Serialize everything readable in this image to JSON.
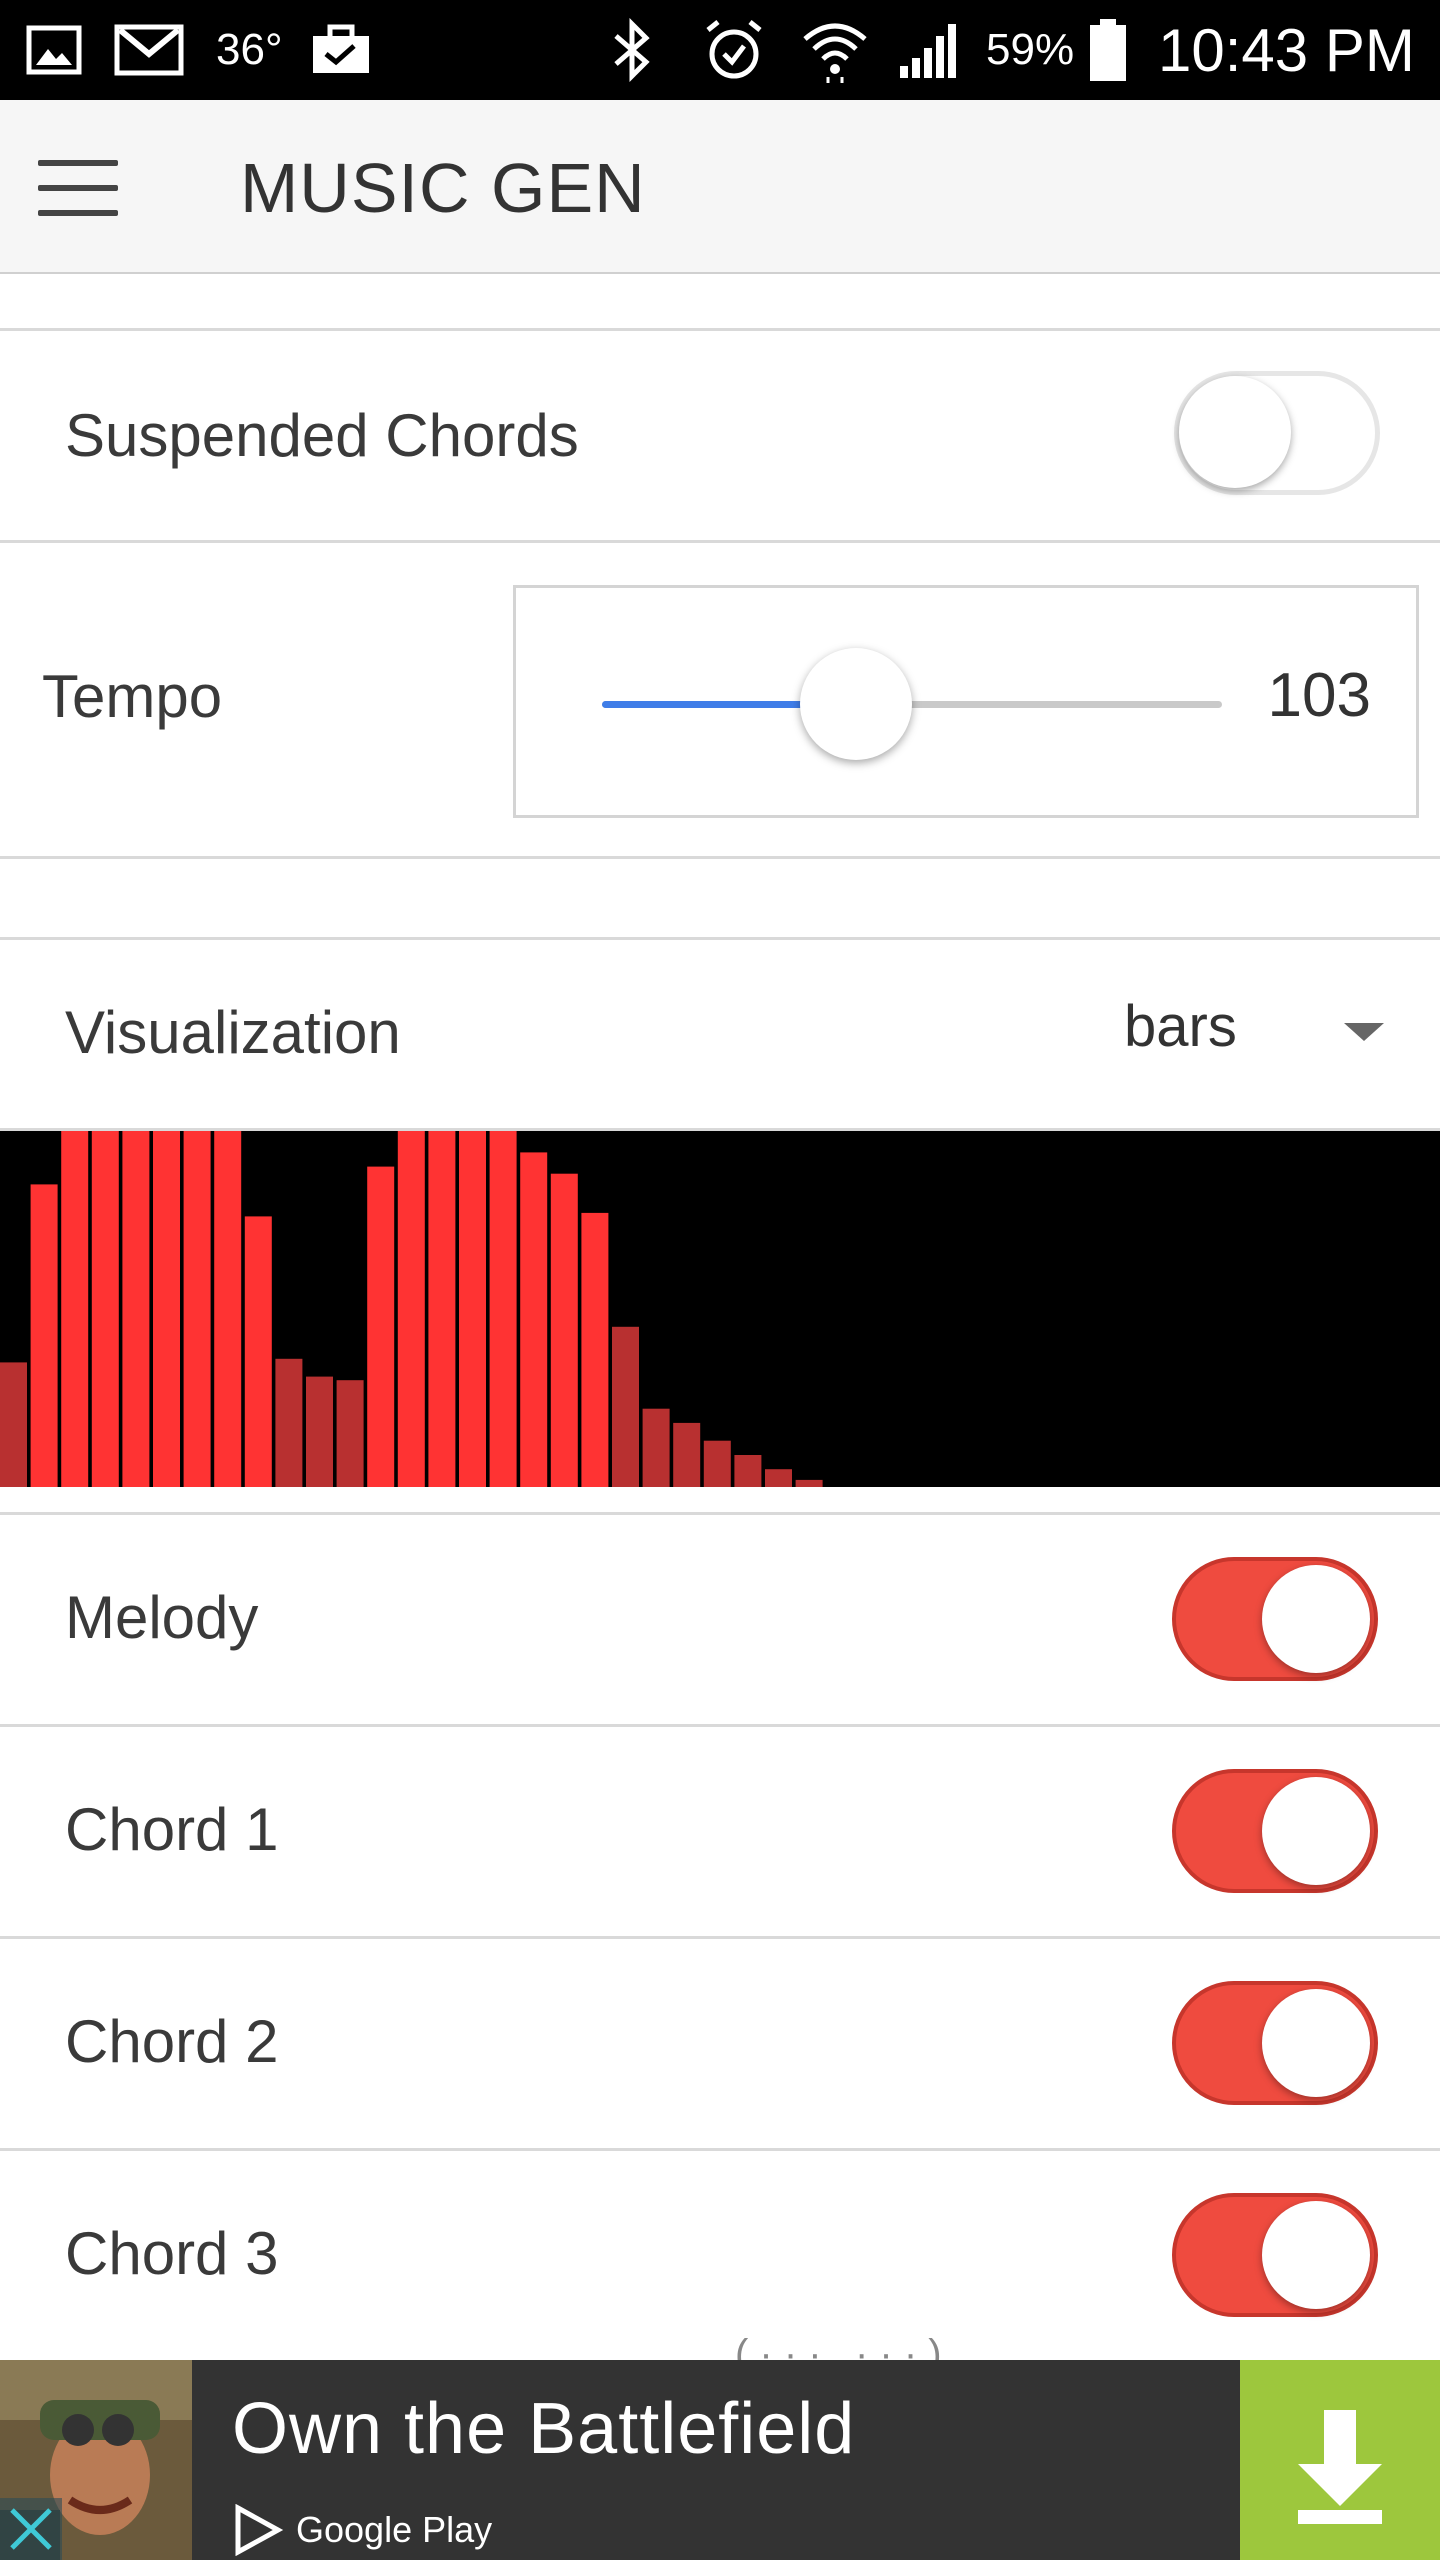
{
  "status_bar": {
    "temperature": "36°",
    "battery": "59%",
    "time": "10:43 PM",
    "icons": [
      "gallery-icon",
      "gmail-icon",
      "briefcase-icon",
      "bluetooth-icon",
      "alarm-icon",
      "wifi-icon",
      "signal-icon",
      "battery-icon"
    ]
  },
  "app_bar": {
    "title": "MUSIC GEN",
    "menu_icon": "hamburger-menu-icon"
  },
  "settings": {
    "suspended_chords": {
      "label": "Suspended Chords",
      "enabled": false
    },
    "tempo": {
      "label": "Tempo",
      "value": "103",
      "fraction": 0.41
    },
    "visualization": {
      "label": "Visualization",
      "selected": "bars"
    }
  },
  "visualizer_bars": [
    0.35,
    0.85,
    1.0,
    1.0,
    1.0,
    1.0,
    1.0,
    1.0,
    0.76,
    0.36,
    0.31,
    0.3,
    0.9,
    1.0,
    1.0,
    1.0,
    1.0,
    0.94,
    0.88,
    0.77,
    0.45,
    0.22,
    0.18,
    0.13,
    0.09,
    0.05,
    0.02
  ],
  "tracks": [
    {
      "label": "Melody",
      "enabled": true
    },
    {
      "label": "Chord 1",
      "enabled": true
    },
    {
      "label": "Chord 2",
      "enabled": true
    },
    {
      "label": "Chord 3",
      "enabled": true
    }
  ],
  "ad": {
    "title": "Own the Battlefield",
    "store": "Google Play",
    "colors": {
      "background": "#333333",
      "download": "#9dc73d"
    }
  },
  "colors": {
    "toggle_on": "#ef4b3f",
    "slider_fill": "#3f7de8",
    "bar_bright": "#ff3333",
    "bar_dim": "#b83030"
  }
}
